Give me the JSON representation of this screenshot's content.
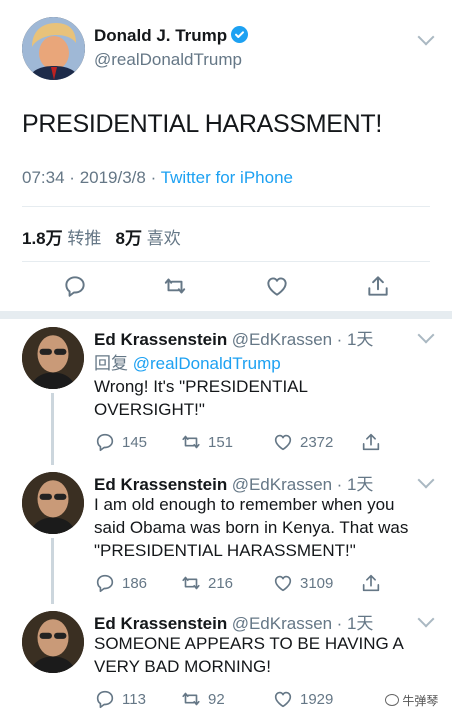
{
  "main_tweet": {
    "display_name": "Donald J. Trump",
    "handle": "@realDonaldTrump",
    "text": "PRESIDENTIAL HARASSMENT!",
    "time": "07:34",
    "date": "2019/3/8",
    "separator": "·",
    "source": "Twitter for iPhone",
    "retweets_count": "1.8万",
    "retweets_label": "转推",
    "likes_count": "8万",
    "likes_label": "喜欢"
  },
  "replies": [
    {
      "display_name": "Ed Krassenstein",
      "handle": "@EdKrassen",
      "age": "· 1天",
      "reply_to_prefix": "回复",
      "reply_to_handle": "@realDonaldTrump",
      "text": "Wrong!  It's \"PRESIDENTIAL\nOVERSIGHT!\"",
      "replies": "145",
      "retweets": "151",
      "likes": "2372"
    },
    {
      "display_name": "Ed Krassenstein",
      "handle": "@EdKrassen",
      "age": "· 1天",
      "text": "I am old enough to remember when you\nsaid Obama was born in Kenya.  That was\n\"PRESIDENTIAL HARASSMENT!\"",
      "replies": "186",
      "retweets": "216",
      "likes": "3109"
    },
    {
      "display_name": "Ed Krassenstein",
      "handle": "@EdKrassen",
      "age": "· 1天",
      "text": "SOMEONE APPEARS TO BE HAVING A\nVERY BAD MORNING!",
      "replies": "113",
      "retweets": "92",
      "likes": "1929"
    }
  ],
  "watermark": "牛弹琴",
  "colors": {
    "accent": "#1da1f2",
    "muted": "#657786",
    "divider": "#e6ecf0"
  },
  "icons": [
    "reply-icon",
    "retweet-icon",
    "like-icon",
    "share-icon",
    "chevron-down-icon",
    "verified-badge-icon"
  ]
}
